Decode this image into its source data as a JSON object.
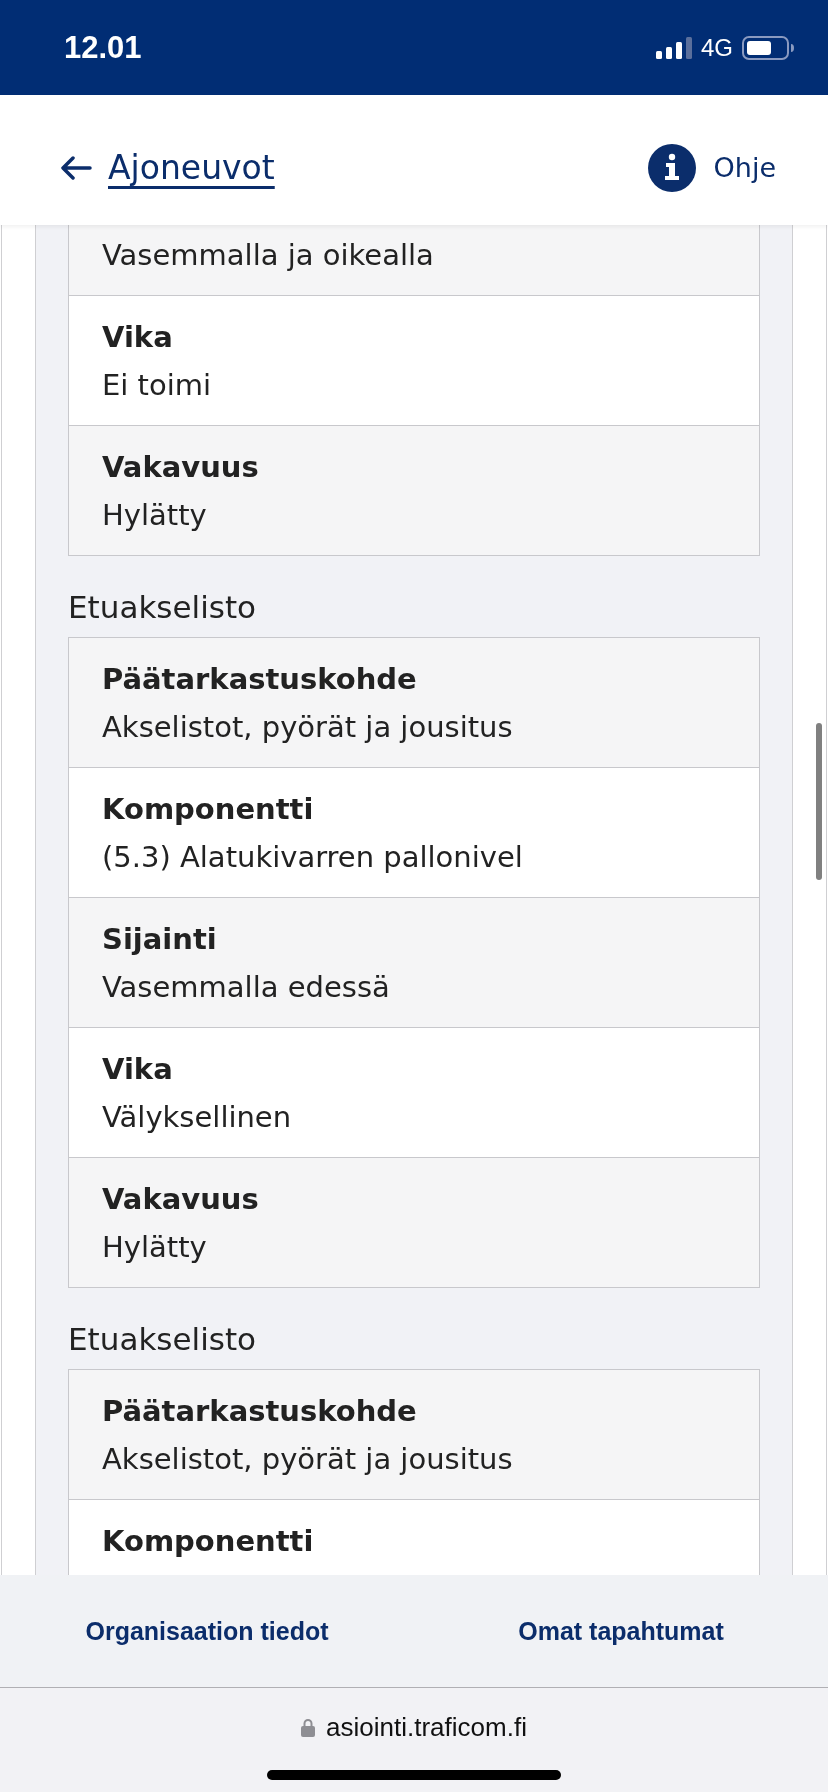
{
  "status_bar": {
    "time": "12.01",
    "network": "4G"
  },
  "header": {
    "back_link": "Ajoneuvot",
    "help": "Ohje"
  },
  "groups": [
    {
      "rows": [
        {
          "value": "Vasemmalla ja oikealla"
        },
        {
          "label": "Vika",
          "value": "Ei toimi"
        },
        {
          "label": "Vakavuus",
          "value": "Hylätty"
        }
      ]
    },
    {
      "heading": "Etuakselisto",
      "rows": [
        {
          "label": "Päätarkastuskohde",
          "value": "Akselistot, pyörät ja jousitus"
        },
        {
          "label": "Komponentti",
          "value": "(5.3) Alatukivarren pallonivel"
        },
        {
          "label": "Sijainti",
          "value": "Vasemmalla edessä"
        },
        {
          "label": "Vika",
          "value": "Välyksellinen"
        },
        {
          "label": "Vakavuus",
          "value": "Hylätty"
        }
      ]
    },
    {
      "heading": "Etuakselisto",
      "rows": [
        {
          "label": "Päätarkastuskohde",
          "value": "Akselistot, pyörät ja jousitus"
        },
        {
          "label": "Komponentti"
        }
      ]
    }
  ],
  "bottom_nav": [
    "Organisaation tiedot",
    "Omat tapahtumat"
  ],
  "address_bar": {
    "url": "asiointi.traficom.fi"
  }
}
